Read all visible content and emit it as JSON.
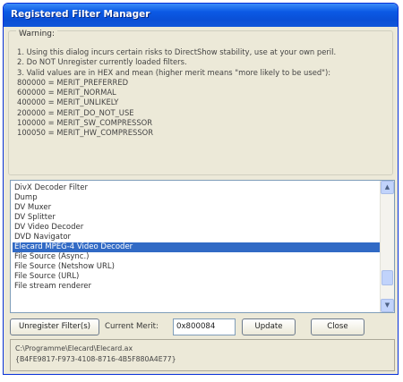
{
  "window": {
    "title": "Registered Filter Manager"
  },
  "warning": {
    "title": "Warning:",
    "lines": [
      "1. Using this dialog incurs certain risks to DirectShow stability, use at your own peril.",
      "2. Do NOT Unregister currently loaded filters.",
      "3. Valid values are in HEX and mean (higher merit means \"more likely to be used\"):",
      "800000 = MERIT_PREFERRED",
      "600000 = MERIT_NORMAL",
      "400000 = MERIT_UNLIKELY",
      "200000 = MERIT_DO_NOT_USE",
      "100000 = MERIT_SW_COMPRESSOR",
      "100050 = MERIT_HW_COMPRESSOR"
    ]
  },
  "filter_list": {
    "items": [
      "DivX Decoder Filter",
      "Dump",
      "DV Muxer",
      "DV Splitter",
      "DV Video Decoder",
      "DVD Navigator",
      "Elecard MPEG-4 Video Decoder",
      "File Source (Async.)",
      "File Source (Netshow URL)",
      "File Source (URL)",
      "File stream renderer"
    ],
    "selected_index": 6
  },
  "controls": {
    "unregister_label": "Unregister Filter(s)",
    "current_merit_label": "Current Merit:",
    "current_merit_value": "0x800084",
    "update_label": "Update",
    "close_label": "Close"
  },
  "details": {
    "path": "C:\\Programme\\Elecard\\Elecard.ax",
    "clsid": "{B4FE9817-F973-4108-8716-4B5F880A4E77}"
  }
}
